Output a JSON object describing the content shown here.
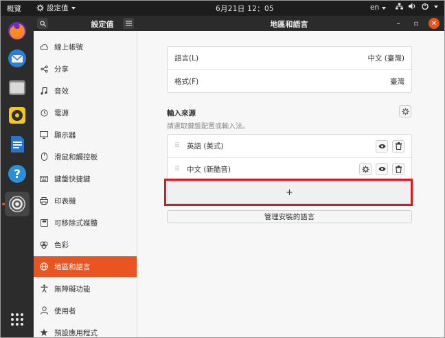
{
  "topbar": {
    "activities": "概覽",
    "app_menu": "設定值",
    "clock": "6月21日  12：05",
    "input_lang": "en"
  },
  "dock": {
    "items": [
      {
        "name": "firefox-icon"
      },
      {
        "name": "thunderbird-icon"
      },
      {
        "name": "files-icon"
      },
      {
        "name": "rhythmbox-icon"
      },
      {
        "name": "writer-icon"
      },
      {
        "name": "help-icon"
      },
      {
        "name": "settings-icon"
      }
    ],
    "apps_grid": "show-apps-icon"
  },
  "header": {
    "sidebar_title": "設定值",
    "main_title": "地區和語言",
    "minimize": "–",
    "maximize": "▫",
    "close": "✕"
  },
  "sidebar": {
    "items": [
      {
        "label": "線上帳號",
        "icon": "cloud-icon"
      },
      {
        "label": "分享",
        "icon": "share-icon"
      },
      {
        "label": "音效",
        "icon": "music-note-icon"
      },
      {
        "label": "電源",
        "icon": "power-icon"
      },
      {
        "label": "顯示器",
        "icon": "monitor-icon"
      },
      {
        "label": "滑鼠和觸控板",
        "icon": "mouse-icon"
      },
      {
        "label": "鍵盤快捷鍵",
        "icon": "keyboard-icon"
      },
      {
        "label": "印表機",
        "icon": "printer-icon"
      },
      {
        "label": "可移除式媒體",
        "icon": "media-icon"
      },
      {
        "label": "色彩",
        "icon": "color-icon"
      },
      {
        "label": "地區和語言",
        "icon": "globe-icon",
        "selected": true
      },
      {
        "label": "無障礙功能",
        "icon": "accessibility-icon"
      },
      {
        "label": "使用者",
        "icon": "user-icon"
      },
      {
        "label": "預設應用程式",
        "icon": "star-icon"
      }
    ]
  },
  "main": {
    "language_label": "語言(L)",
    "language_value": "中文 (臺灣)",
    "format_label": "格式(F)",
    "format_value": "臺灣",
    "input_sources_title": "輸入來源",
    "input_sources_hint": "請選取鍵盤配置或輸入法。",
    "sources": [
      {
        "label": "英語 (美式)",
        "has_settings": false
      },
      {
        "label": "中文 (新酷音)",
        "has_settings": true
      }
    ],
    "add_label": "+",
    "manage_label": "管理安裝的語言"
  },
  "colors": {
    "accent": "#e95420",
    "highlight": "#e0141e"
  }
}
